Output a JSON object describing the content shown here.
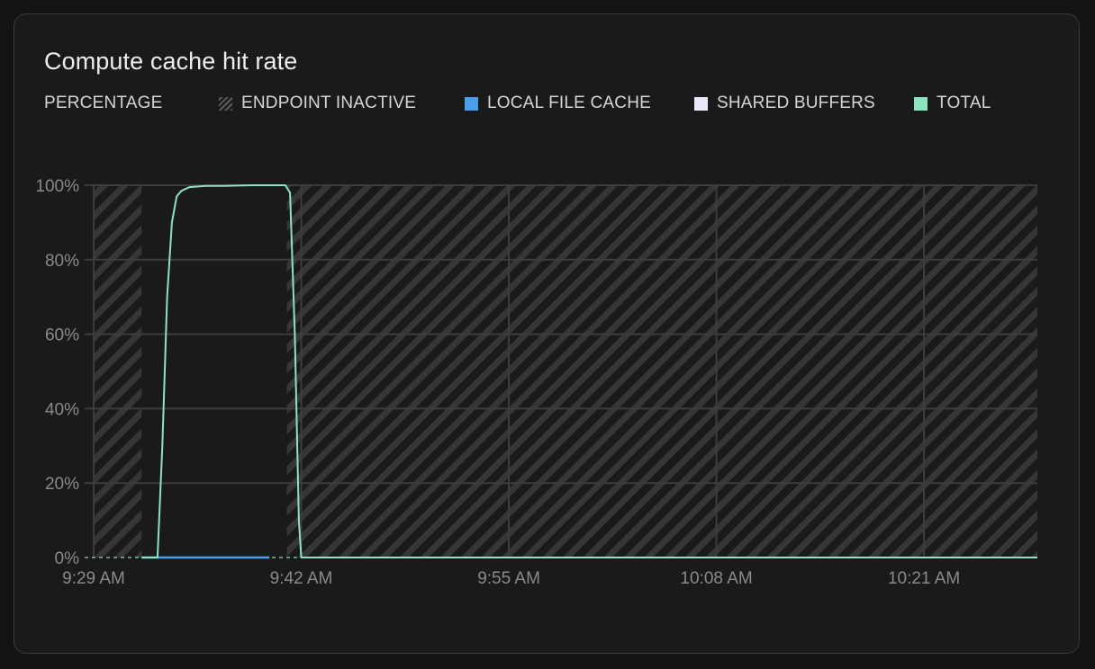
{
  "chart_data": {
    "type": "line",
    "title": "Compute cache hit rate",
    "ylabel": "PERCENTAGE",
    "ylim": [
      0,
      100
    ],
    "y_ticks": [
      "0%",
      "20%",
      "40%",
      "60%",
      "80%",
      "100%"
    ],
    "y_tick_values": [
      0,
      20,
      40,
      60,
      80,
      100
    ],
    "x_ticks": [
      "9:29 AM",
      "9:42 AM",
      "9:55 AM",
      "10:08 AM",
      "10:21 AM"
    ],
    "x_tick_minutes": [
      569,
      582,
      595,
      608,
      621
    ],
    "xlim_minutes": [
      569,
      628.1
    ],
    "grid": true,
    "legend_position": "top-left",
    "legend": [
      {
        "label": "ENDPOINT INACTIVE",
        "kind": "hatch",
        "color": "#5c5c5c"
      },
      {
        "label": "LOCAL FILE CACHE",
        "kind": "solid",
        "color": "#4b9fea"
      },
      {
        "label": "SHARED BUFFERS",
        "kind": "solid",
        "color": "#ede7fb"
      },
      {
        "label": "TOTAL",
        "kind": "solid",
        "color": "#8ee3c0"
      }
    ],
    "inactive_ranges": [
      {
        "label": "ENDPOINT INACTIVE",
        "start": 569,
        "end": 572
      },
      {
        "label": "ENDPOINT INACTIVE",
        "start": 581.1,
        "end": 628.1
      }
    ],
    "series": [
      {
        "name": "TOTAL",
        "color": "#8ee3c0",
        "x": [
          572,
          573,
          573.3,
          573.6,
          573.9,
          574.2,
          574.5,
          575,
          576,
          577,
          578,
          579,
          580,
          581,
          581.3,
          581.6,
          581.85,
          582,
          628.1
        ],
        "values": [
          0,
          0,
          30,
          70,
          90,
          97,
          98.5,
          99.5,
          99.8,
          99.8,
          99.9,
          100,
          100,
          100,
          98,
          60,
          10,
          0,
          0
        ]
      },
      {
        "name": "LOCAL FILE CACHE",
        "color": "#4b9fea",
        "x": [
          572,
          580
        ],
        "values": [
          0,
          0
        ]
      }
    ]
  }
}
